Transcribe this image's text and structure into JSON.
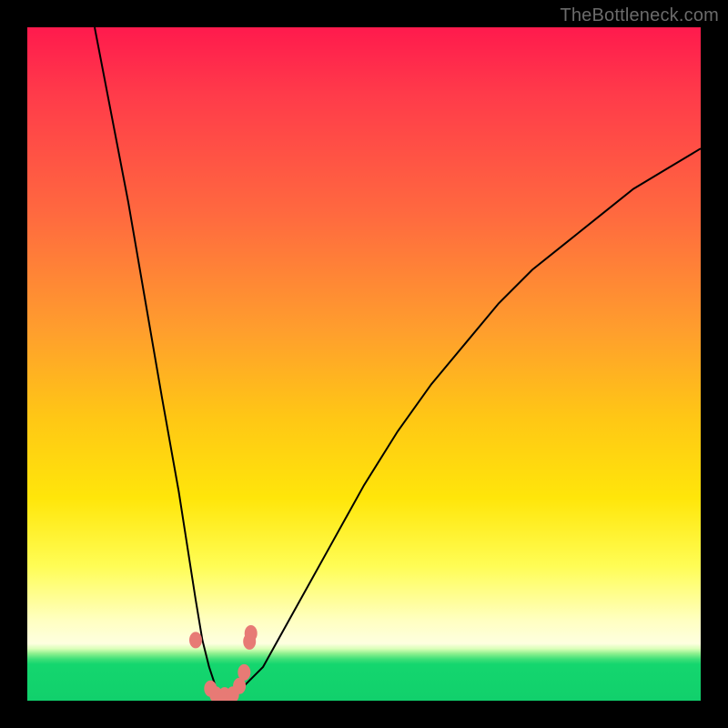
{
  "watermark": "TheBottleneck.com",
  "colors": {
    "frame": "#000000",
    "gradient_top": "#ff1a4d",
    "gradient_mid": "#ffe60a",
    "gradient_bottom": "#11d06c",
    "curve": "#000000",
    "marker": "#e77a75"
  },
  "chart_data": {
    "type": "line",
    "title": "",
    "xlabel": "",
    "ylabel": "",
    "xlim": [
      0,
      100
    ],
    "ylim": [
      0,
      100
    ],
    "x": [
      10,
      15,
      20,
      22.5,
      25,
      26,
      27,
      28,
      29,
      30,
      32,
      35,
      40,
      45,
      50,
      55,
      60,
      65,
      70,
      75,
      80,
      85,
      90,
      95,
      100
    ],
    "values": [
      100,
      74,
      45,
      31,
      15,
      9,
      5,
      2,
      1,
      1,
      2,
      5,
      14,
      23,
      32,
      40,
      47,
      53,
      59,
      64,
      68,
      72,
      76,
      79,
      82
    ],
    "comment": "V-shaped bottleneck curve. x is an arbitrary balance axis (0–100), y is mismatch percentage (0 best, 100 worst). Minimum near x≈29.",
    "markers": [
      {
        "x": 25.0,
        "y": 9.0
      },
      {
        "x": 27.2,
        "y": 1.8
      },
      {
        "x": 28.0,
        "y": 0.9
      },
      {
        "x": 29.3,
        "y": 0.8
      },
      {
        "x": 30.5,
        "y": 0.9
      },
      {
        "x": 31.5,
        "y": 2.2
      },
      {
        "x": 32.2,
        "y": 4.2
      },
      {
        "x": 33.0,
        "y": 8.8
      },
      {
        "x": 33.2,
        "y": 10.0
      }
    ]
  }
}
